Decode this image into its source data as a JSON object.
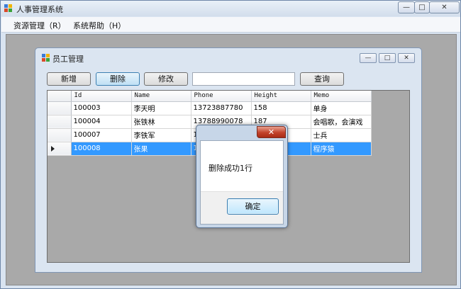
{
  "app": {
    "title": "人事管理系统",
    "caption_buttons": [
      "—",
      "□",
      "✕"
    ]
  },
  "menu": [
    {
      "label": "资源管理（R）"
    },
    {
      "label": "系统帮助（H）"
    }
  ],
  "child": {
    "title": "员工管理",
    "caption_buttons": [
      "—",
      "□",
      "✕"
    ],
    "toolbar": {
      "add": "新增",
      "delete": "删除",
      "edit": "修改",
      "search_value": "",
      "query": "查询"
    }
  },
  "grid": {
    "columns": [
      "Id",
      "Name",
      "Phone",
      "Height",
      "Memo"
    ],
    "rows": [
      {
        "id": "100003",
        "name": "李天明",
        "phone": "13723887780",
        "height": "158",
        "memo": "单身"
      },
      {
        "id": "100004",
        "name": "张铁林",
        "phone": "13788990078",
        "height": "187",
        "memo": "会唱歌，会演戏"
      },
      {
        "id": "100007",
        "name": "李铁军",
        "phone": "1",
        "height": "",
        "memo": "士兵"
      },
      {
        "id": "100008",
        "name": "张果",
        "phone": "1",
        "height": "",
        "memo": "程序猿"
      }
    ],
    "selected_row": 3
  },
  "dialog": {
    "close": "✕",
    "message": "删除成功1行",
    "ok": "确定"
  },
  "colors": {
    "selection": "#3399ff",
    "mdi_background": "#a9a9a9",
    "close_button": "#c2422b"
  },
  "icons": [
    "app-icon",
    "window-icon",
    "row-pointer-icon"
  ]
}
